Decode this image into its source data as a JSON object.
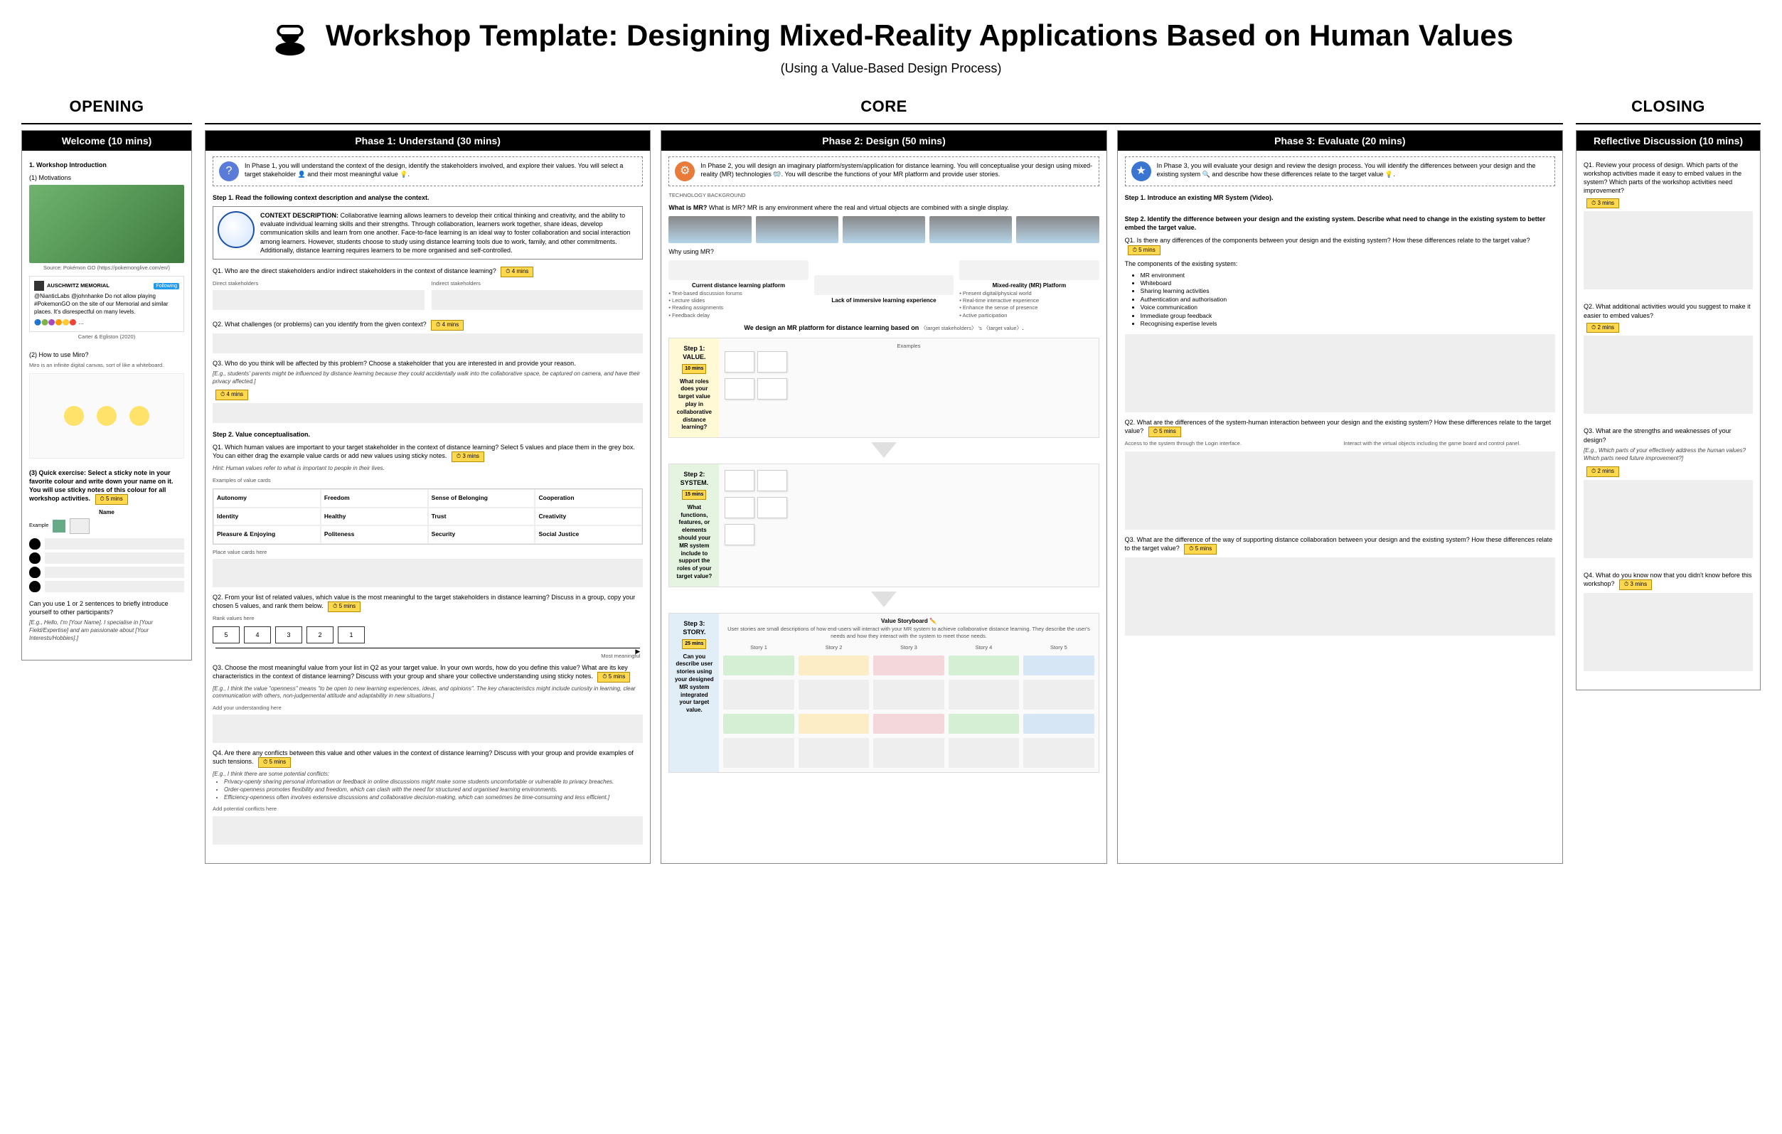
{
  "title": "Workshop Template: Designing Mixed-Reality Applications Based on Human Values",
  "subtitle": "(Using a Value-Based Design Process)",
  "stages": {
    "opening": "OPENING",
    "core": "CORE",
    "closing": "CLOSING"
  },
  "opening": {
    "panel_title": "Welcome (10 mins)",
    "s1": "1. Workshop Introduction",
    "s1a": "(1) Motivations",
    "img_caption": "Source: Pokémon GO (https://pokemonglive.com/en/)",
    "tweet": "@NianticLabs @johnhanke Do not allow playing #PokemonGO on the site of our Memorial and similar places. It's disrespectful on many levels.",
    "tweet_src": "Carter & Egliston (2020)",
    "s1b": "(2) How to use Miro?",
    "miro_hint": "Miro is an infinite digital canvas, sort of like a whiteboard.",
    "s1c": "(3) Quick exercise: Select a sticky note in your favorite colour and write down your name on it. You will use sticky notes of this colour for all workshop activities.",
    "timer1": "5 mins",
    "name_hdr": "Name",
    "example": "Example",
    "q_intro": "Can you use 1 or 2 sentences to briefly introduce yourself to other participants?",
    "q_intro_hint": "[E.g., Hello, I'm [Your Name]. I specialise in [Your Field/Expertise] and am passionate about [Your Interests/Hobbies].]"
  },
  "phase1": {
    "panel_title": "Phase 1: Understand (30 mins)",
    "callout": "In Phase 1, you will understand the context of the design, identify the stakeholders involved, and explore their values. You will select a target stakeholder 👤 and their most meaningful value 💡.",
    "step1": "Step 1. Read the following context description and analyse the context.",
    "context_label": "CONTEXT DESCRIPTION:",
    "context": "Collaborative learning allows learners to develop their critical thinking and creativity, and the ability to evaluate individual learning skills and their strengths. Through collaboration, learners work together, share ideas, develop communication skills and learn from one another. Face-to-face learning is an ideal way to foster collaboration and social interaction among learners. However, students choose to study using distance learning tools due to work, family, and other commitments. Additionally, distance learning requires learners to be more organised and self-controlled.",
    "q1": "Q1. Who are the direct stakeholders and/or indirect stakeholders in the context of distance learning?",
    "q1_t": "4 mins",
    "q1_a": "Direct stakeholders",
    "q1_b": "Indirect stakeholders",
    "q2": "Q2. What challenges (or problems) can you identify from the given context?",
    "q2_t": "4 mins",
    "q3": "Q3. Who do you think will be affected by this problem? Choose a stakeholder that you are interested in and provide your reason.",
    "q3_hint": "[E.g., students' parents might be influenced by distance learning because they could accidentally walk into the collaborative space, be captured on camera, and have their privacy affected.]",
    "q3_t": "4 mins",
    "step2": "Step 2. Value conceptualisation.",
    "s2q1": "Q1. Which human values are important to your target stakeholder in the context of distance learning? Select 5 values and place them in the grey box. You can either drag the example value cards or add new values using sticky notes.",
    "s2q1_t": "3 mins",
    "s2q1_hint": "Hint: Human values refer to what is important to people in their lives.",
    "vcards_label": "Examples of value cards",
    "values": [
      "Autonomy",
      "Freedom",
      "Sense of Belonging",
      "Cooperation",
      "Identity",
      "Healthy",
      "Trust",
      "Creativity",
      "Pleasure & Enjoying",
      "Politeness",
      "Security",
      "Social Justice"
    ],
    "place_here": "Place value cards here",
    "s2q2": "Q2. From your list of related values, which value is the most meaningful to the target stakeholders in distance learning? Discuss in a group, copy your chosen 5 values, and rank them below.",
    "s2q2_t": "5 mins",
    "rank_label": "Rank values here",
    "ranks": [
      "5",
      "4",
      "3",
      "2",
      "1"
    ],
    "most": "Most meaningful",
    "s2q3a": "Q3. Choose the most meaningful value from your list in Q2 as your target value. In your own words, how do you define this value? What are its key characteristics in the context of distance learning? Discuss with your group and share your collective understanding using sticky notes.",
    "s2q3_t": "5 mins",
    "s2q3_hint": "[E.g., I think the value \"openness\" means \"to be open to new learning experiences, ideas, and opinions\". The key characteristics might include curiosity in learning, clear communication with others, non-judgemental attitude and adaptability in new situations.]",
    "add_und": "Add your understanding here",
    "s2q4": "Q4. Are there any conflicts between this value and other values in the context of distance learning? Discuss with your group and provide examples of such tensions.",
    "s2q4_t": "5 mins",
    "s2q4_hint1": "[E.g., I think there are some potential conflicts:",
    "s2q4_b1": "Privacy-openly sharing personal information or feedback in online discussions might make some students uncomfortable or vulnerable to privacy breaches.",
    "s2q4_b2": "Order-openness promotes flexibility and freedom, which can clash with the need for structured and organised learning environments.",
    "s2q4_b3": "Efficiency-openness often involves extensive discussions and collaborative decision-making, which can sometimes be time-consuming and less efficient.]",
    "add_conf": "Add potential conflicts here"
  },
  "phase2": {
    "panel_title": "Phase 2: Design (50 mins)",
    "callout": "In Phase 2, you will design an imaginary platform/system/application for distance learning. You will conceptualise your design using mixed-reality (MR) technologies 🥽. You will describe the functions of your MR platform and provide user stories.",
    "tech_bg": "TECHNOLOGY BACKGROUND",
    "what_mr": "What is MR? MR is any environment where the real and virtual objects are combined with a single display.",
    "why_mr": "Why using MR?",
    "why_a_t": "Current distance learning platform",
    "why_a_items": "• Text-based discussion forums\n• Lecture slides\n• Reading assignments\n• Feedback delay",
    "why_b": "Lack of immersive learning experience",
    "why_c_t": "Mixed-reality (MR) Platform",
    "why_c_items": "• Present digital/physical world\n• Real-time interactive experience\n• Enhance the sense of presence\n• Active participation",
    "premise_a": "We design an MR platform for distance learning based on",
    "premise_b": "〈target stakeholders〉  's  〈target value〉",
    "step1_title": "Step 1: VALUE.",
    "step1_t": "10 mins",
    "step1_q": "What roles does your target value play in collaborative distance learning?",
    "examples": "Examples",
    "step2_title": "Step 2: SYSTEM.",
    "step2_t": "15 mins",
    "step2_q": "What functions, features, or elements should your MR system include to support the roles of your target value?",
    "step3_title": "Step 3: STORY.",
    "step3_t": "25 mins",
    "step3_q": "Can you describe user stories using your designed MR system integrated your target value.",
    "sb_title": "Value Storyboard ✏️",
    "sb_hint": "User stories are small descriptions of how end-users will interact with your MR system to achieve collaborative distance learning. They describe the user's needs and how they interact with the system to meet those needs.",
    "sb_heads": [
      "Story 1",
      "Story 2",
      "Story 3",
      "Story 4",
      "Story 5"
    ]
  },
  "phase3": {
    "panel_title": "Phase 3: Evaluate (20 mins)",
    "callout": "In Phase 3, you will evaluate your design and review the design process. You will identify the differences between your design and the existing system 🔍 and describe how these differences relate to the target value 💡.",
    "step1": "Step 1. Introduce an existing MR System (Video).",
    "step2": "Step 2. Identify the difference between your design and the existing system. Describe what need to change in the existing system to better embed the target value.",
    "q1": "Q1. Is there any differences of the components between your design and the existing system? How these differences relate to the target value?",
    "q1_t": "5 mins",
    "comp_label": "The components of the existing system:",
    "components": [
      "MR environment",
      "Whiteboard",
      "Sharing learning activities",
      "Authentication and authorisation",
      "Voice communication",
      "Immediate group feedback",
      "Recognising expertise levels"
    ],
    "q2": "Q2. What are the differences of the system-human interaction between your design and the existing system? How these differences relate to the target value?",
    "q2_t": "5 mins",
    "q2_a": "Access to the system through the Login interface.",
    "q2_b": "Interact with the virtual objects including the game board and control panel.",
    "q3": "Q3. What are the difference of the way of supporting distance collaboration between your design and the existing system? How these differences relate to the target value?",
    "q3_t": "5 mins"
  },
  "closing": {
    "panel_title": "Reflective Discussion (10 mins)",
    "q1": "Q1. Review your process of design. Which parts of the workshop activities made it easy to embed values in the system? Which parts of the workshop activities need improvement?",
    "q1_t": "3 mins",
    "q2": "Q2. What additional activities would you suggest to make it easier to embed values?",
    "q2_t": "2 mins",
    "q3": "Q3. What are the strengths and weaknesses of your design?",
    "q3_hint": "[E.g., Which parts of your effectively address the human values? Which parts need future improvement?]",
    "q3_t": "2 mins",
    "q4": "Q4. What do you know now that you didn't know before this workshop?",
    "q4_t": "3 mins"
  }
}
